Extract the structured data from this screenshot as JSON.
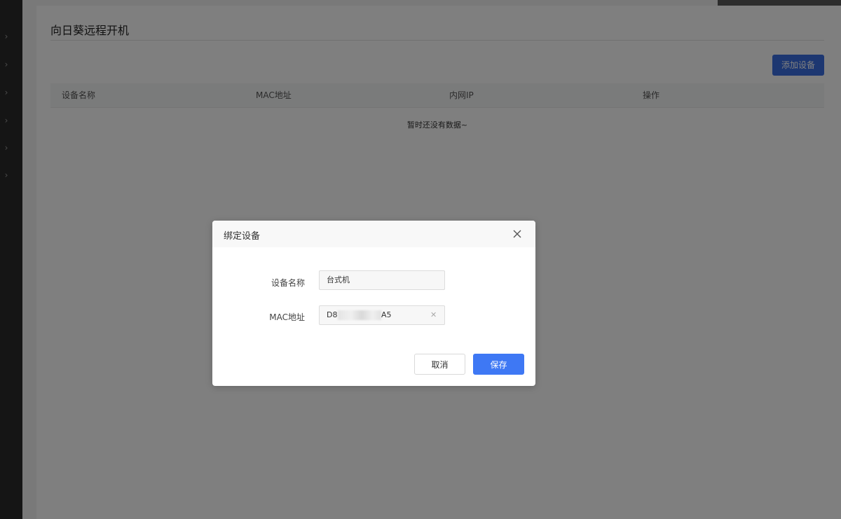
{
  "page": {
    "title": "向日葵远程开机",
    "add_device_label": "添加设备",
    "empty_text": "暂时还没有数据~"
  },
  "table": {
    "columns": [
      "设备名称",
      "MAC地址",
      "内网IP",
      "操作"
    ]
  },
  "sidebar": {
    "items": [
      "chevron-right-icon",
      "chevron-right-icon",
      "chevron-right-icon",
      "chevron-right-icon",
      "chevron-right-icon",
      "chevron-right-icon"
    ]
  },
  "modal": {
    "title": "绑定设备",
    "fields": [
      {
        "label": "设备名称",
        "value": "台式机"
      },
      {
        "label": "MAC地址",
        "value_prefix": "D8",
        "value_suffix": "A5"
      }
    ],
    "cancel_label": "取消",
    "save_label": "保存"
  },
  "colors": {
    "primary": "#3e78f4",
    "add_button": "#3b6fe3",
    "sidebar": "#2b2b2b"
  }
}
